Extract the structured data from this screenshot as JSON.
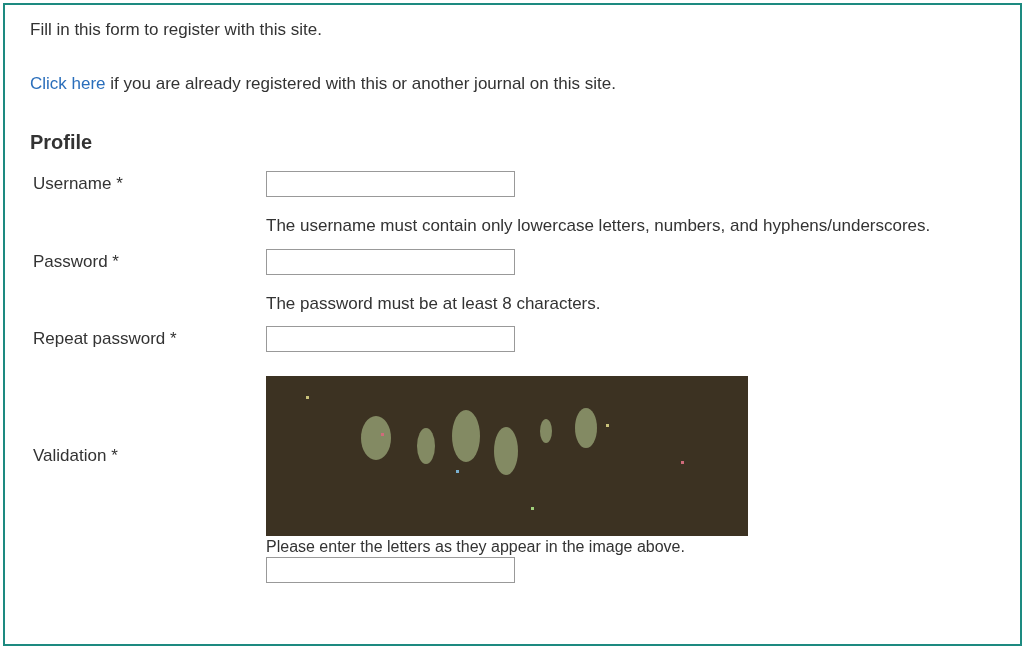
{
  "intro": "Fill in this form to register with this site.",
  "login_note": {
    "link": "Click here",
    "text": " if you are already registered with this or another journal on this site."
  },
  "section_title": "Profile",
  "fields": [
    {
      "kind": "text",
      "label": "Username *",
      "hint": "The username must contain only lowercase letters, numbers, and hyphens/underscores."
    },
    {
      "kind": "text",
      "label": "Password *",
      "hint": "The password must be at least 8 characters."
    },
    {
      "kind": "text",
      "label": "Repeat password *"
    },
    {
      "kind": "captcha",
      "label": "Validation *",
      "hint": "Please enter the letters as they appear in the image above."
    }
  ]
}
